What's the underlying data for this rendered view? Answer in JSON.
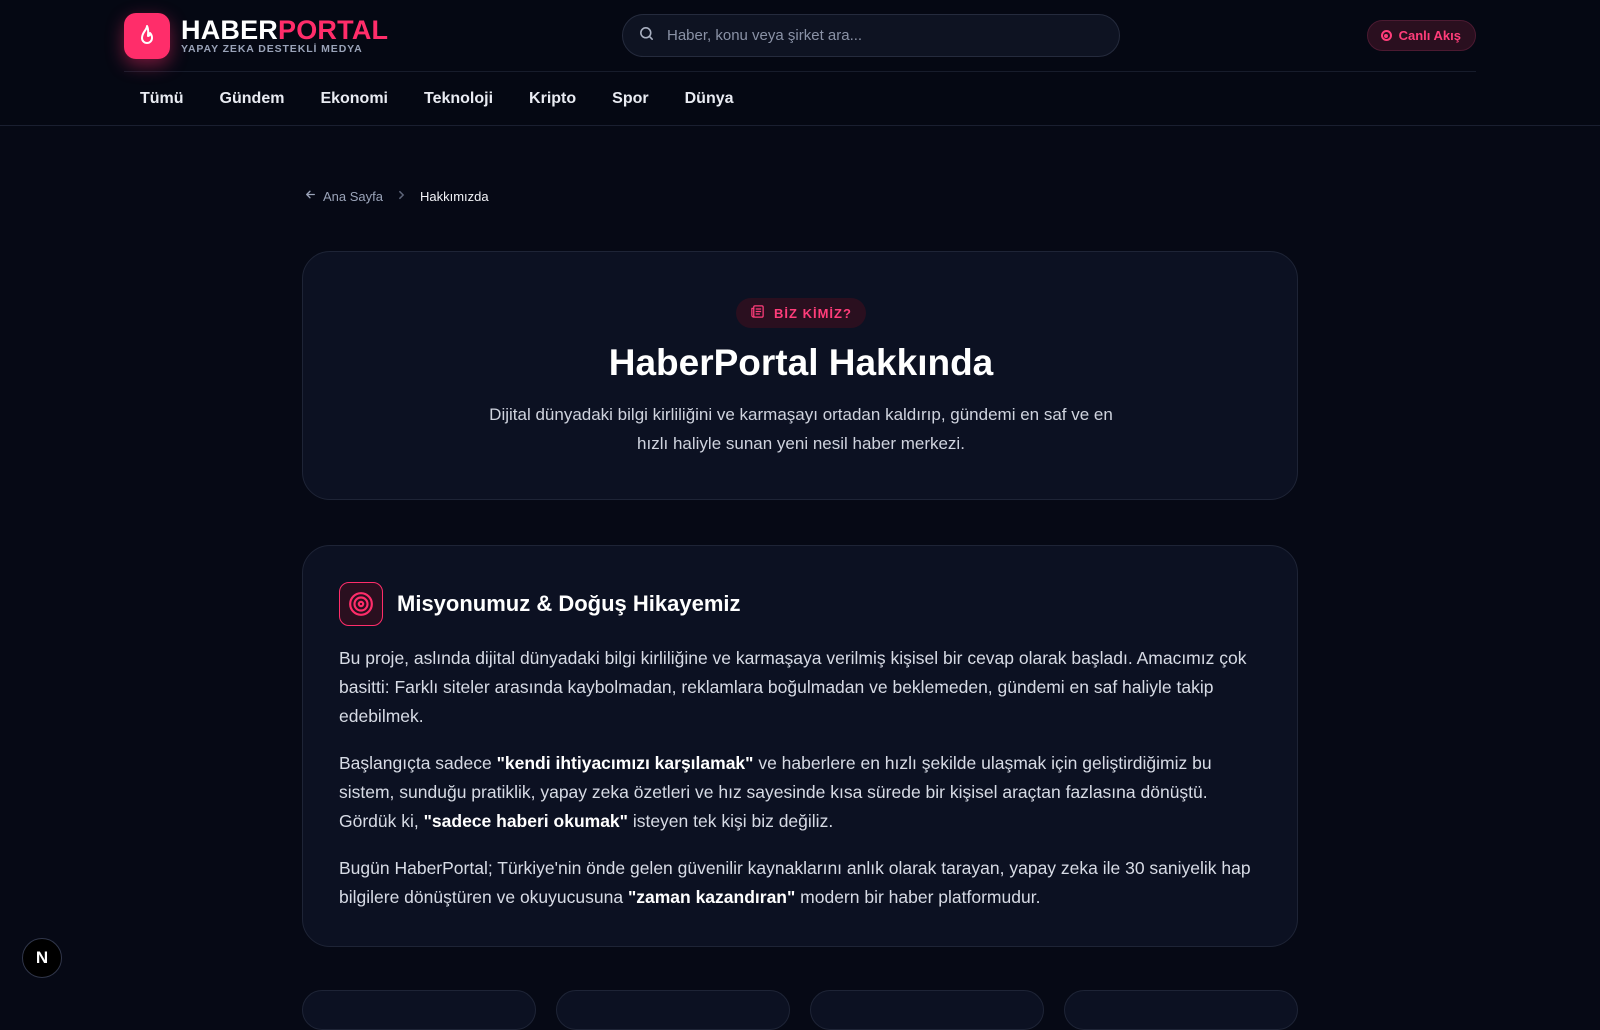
{
  "header": {
    "logo": {
      "name_part1": "HABER",
      "name_part2": "PORTAL",
      "tagline": "YAPAY ZEKA DESTEKLİ MEDYA"
    },
    "search": {
      "placeholder": "Haber, konu veya şirket ara..."
    },
    "live_button": {
      "label": "Canlı Akış"
    },
    "nav": [
      "Tümü",
      "Gündem",
      "Ekonomi",
      "Teknoloji",
      "Kripto",
      "Spor",
      "Dünya"
    ]
  },
  "breadcrumb": {
    "home": "Ana Sayfa",
    "current": "Hakkımızda"
  },
  "hero": {
    "badge": "BİZ KİMİZ?",
    "title": "HaberPortal Hakkında",
    "subtitle": "Dijital dünyadaki bilgi kirliliğini ve karmaşayı ortadan kaldırıp, gündemi en saf ve en hızlı haliyle sunan yeni nesil haber merkezi."
  },
  "mission": {
    "title": "Misyonumuz & Doğuş Hikayemiz",
    "p1": "Bu proje, aslında dijital dünyadaki bilgi kirliliğine ve karmaşaya verilmiş kişisel bir cevap olarak başladı. Amacımız çok basitti: Farklı siteler arasında kaybolmadan, reklamlara boğulmadan ve beklemeden, gündemi en saf haliyle takip edebilmek.",
    "p2_a": "Başlangıçta sadece ",
    "p2_b": "\"kendi ihtiyacımızı karşılamak\"",
    "p2_c": " ve haberlere en hızlı şekilde ulaşmak için geliştirdiğimiz bu sistem, sunduğu pratiklik, yapay zeka özetleri ve hız sayesinde kısa sürede bir kişisel araçtan fazlasına dönüştü. Gördük ki, ",
    "p2_d": "\"sadece haberi okumak\"",
    "p2_e": " isteyen tek kişi biz değiliz.",
    "p3_a": "Bugün HaberPortal; Türkiye'nin önde gelen güvenilir kaynaklarını anlık olarak tarayan, yapay zeka ile 30 saniyelik hap bilgilere dönüştüren ve okuyucusuna ",
    "p3_b": "\"zaman kazandıran\"",
    "p3_c": " modern bir haber platformudur."
  },
  "dev_badge": {
    "label": "N"
  },
  "colors": {
    "accent": "#ff2d6a",
    "background": "#060915",
    "card": "#0c1122"
  }
}
